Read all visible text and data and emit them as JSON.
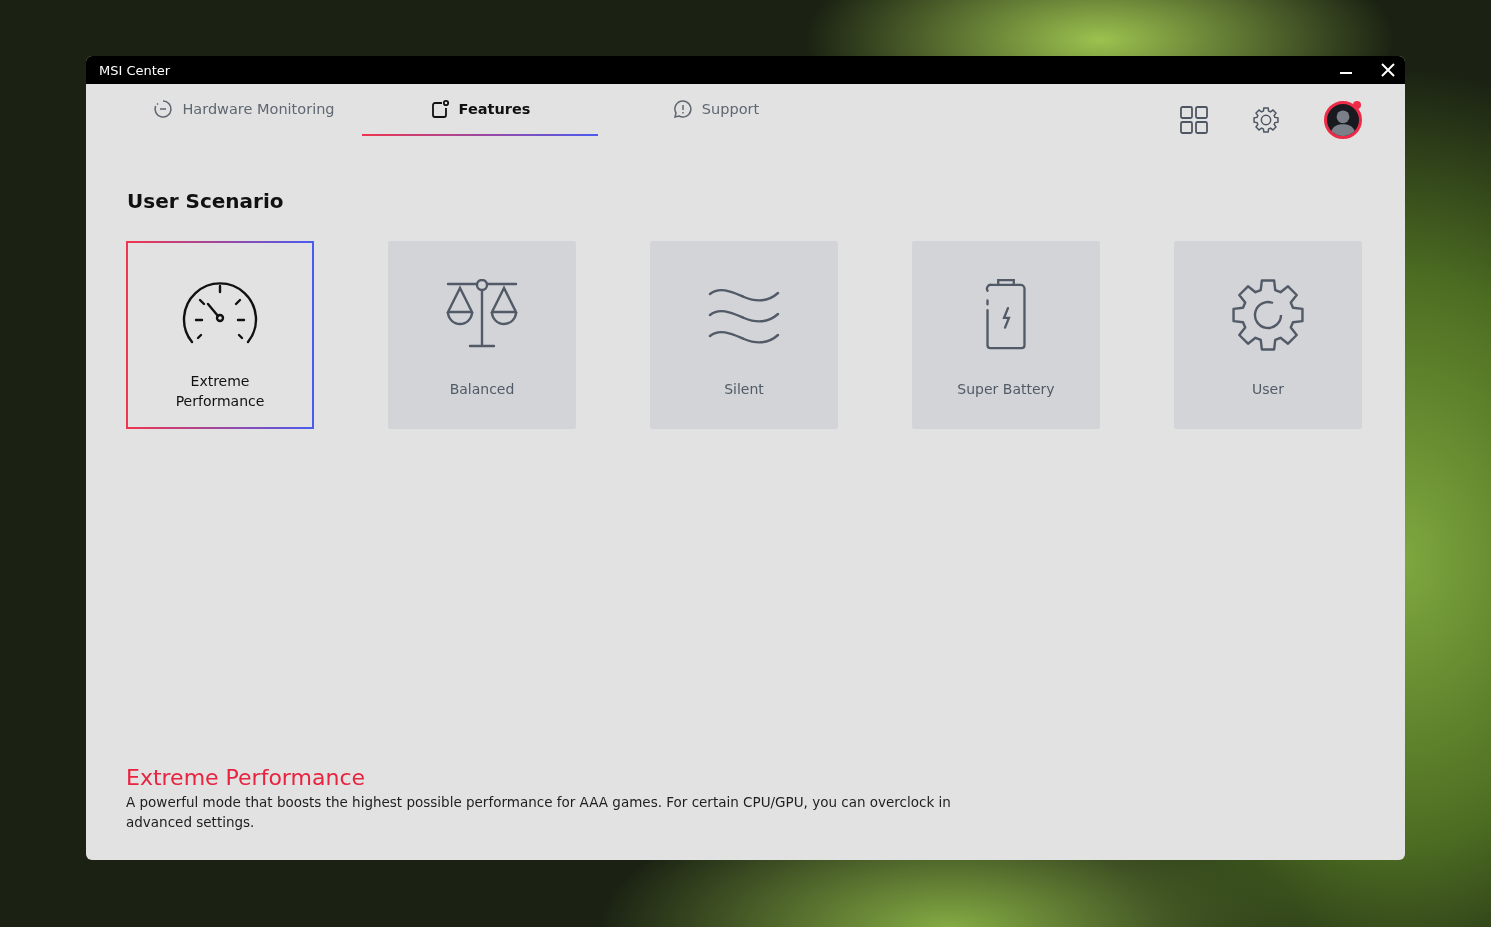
{
  "window": {
    "title": "MSI Center"
  },
  "tabs": [
    {
      "label": "Hardware Monitoring",
      "kind": "monitor",
      "selected": false
    },
    {
      "label": "Features",
      "kind": "features",
      "selected": true
    },
    {
      "label": "Support",
      "kind": "support",
      "selected": false
    }
  ],
  "account": {
    "notification": true
  },
  "section_title": "User Scenario",
  "scenarios": [
    {
      "label": "Extreme Performance",
      "kind": "gauge",
      "selected": true
    },
    {
      "label": "Balanced",
      "kind": "scale",
      "selected": false
    },
    {
      "label": "Silent",
      "kind": "waves",
      "selected": false
    },
    {
      "label": "Super Battery",
      "kind": "battery",
      "selected": false
    },
    {
      "label": "User",
      "kind": "gear",
      "selected": false
    }
  ],
  "description": {
    "title": "Extreme Performance",
    "text": "A powerful mode that boosts the highest possible performance for AAA games. For certain CPU/GPU, you can overclock in advanced settings."
  }
}
